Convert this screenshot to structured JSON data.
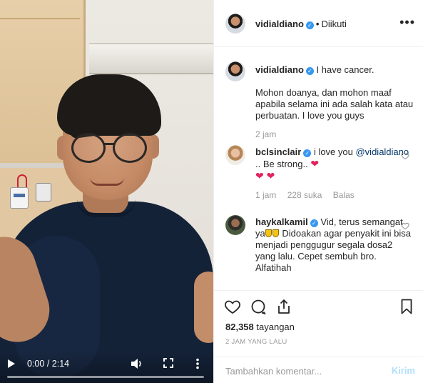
{
  "video": {
    "current_time": "0:00",
    "separator": "/",
    "duration": "2:14",
    "progress_fraction": 0.0
  },
  "post": {
    "header": {
      "username": "vidialdiano",
      "dot": "•",
      "follow_status": "Diikuti",
      "more": "•••"
    },
    "caption": {
      "username": "vidialdiano",
      "first_line": "I have cancer.",
      "second_para": "Mohon doanya, dan mohon maaf apabila selama ini ada salah kata atau perbuatan. I love you guys",
      "age": "2 jam"
    },
    "comments": [
      {
        "username": "bclsinclair",
        "text_before_mention": "i love you",
        "mention": "@vidialdiano",
        "text_after_mention": ".. Be strong..",
        "hearts": "❤ ❤",
        "heart_after_strong": "❤",
        "age": "1 jam",
        "likes": "228 suka",
        "reply": "Balas"
      },
      {
        "username": "haykalkamil",
        "text_part1": "Vid, terus semangat ya",
        "text_part2": "Didoakan agar penyakit ini bisa menjadi penggugur segala dosa2 yang lalu. Cepet sembuh bro. Alfatihah"
      }
    ],
    "views": {
      "count": "82,358",
      "label": "tayangan"
    },
    "time_ago": "2 JAM YANG LALU",
    "add_comment": {
      "placeholder": "Tambahkan komentar...",
      "post_label": "Kirim"
    }
  },
  "icons": {
    "heart": "heart-icon",
    "comment": "comment-icon",
    "share": "share-icon",
    "save": "bookmark-icon",
    "verified": "verified-badge-icon",
    "play": "play-icon",
    "volume": "volume-icon",
    "fullscreen": "fullscreen-icon",
    "more_vertical": "more-vertical-icon"
  },
  "colors": {
    "verified_blue": "#3897f0",
    "mention_blue": "#003569",
    "muted_gray": "#999999",
    "heart_red": "#e0245e",
    "post_button_disabled": "#b2dffc"
  }
}
